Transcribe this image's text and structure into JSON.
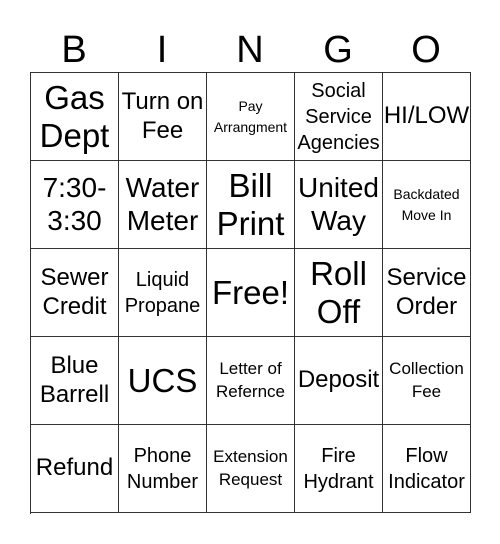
{
  "header": {
    "letters": [
      "B",
      "I",
      "N",
      "G",
      "O"
    ]
  },
  "card": {
    "rows": [
      [
        "Gas Dept",
        "Turn on Fee",
        "Pay Arrangment",
        "Social Service Agencies",
        "HI/LOW"
      ],
      [
        "7:30-3:30",
        "Water Meter",
        "Bill Print",
        "United Way",
        "Backdated Move In"
      ],
      [
        "Sewer Credit",
        "Liquid Propane",
        "Free!",
        "Roll Off",
        "Service Order"
      ],
      [
        "Blue Barrell",
        "UCS",
        "Letter of Refernce",
        "Deposit",
        "Collection Fee"
      ],
      [
        "Refund",
        "Phone Number",
        "Extension Request",
        "Fire Hydrant",
        "Flow Indicator"
      ]
    ]
  }
}
